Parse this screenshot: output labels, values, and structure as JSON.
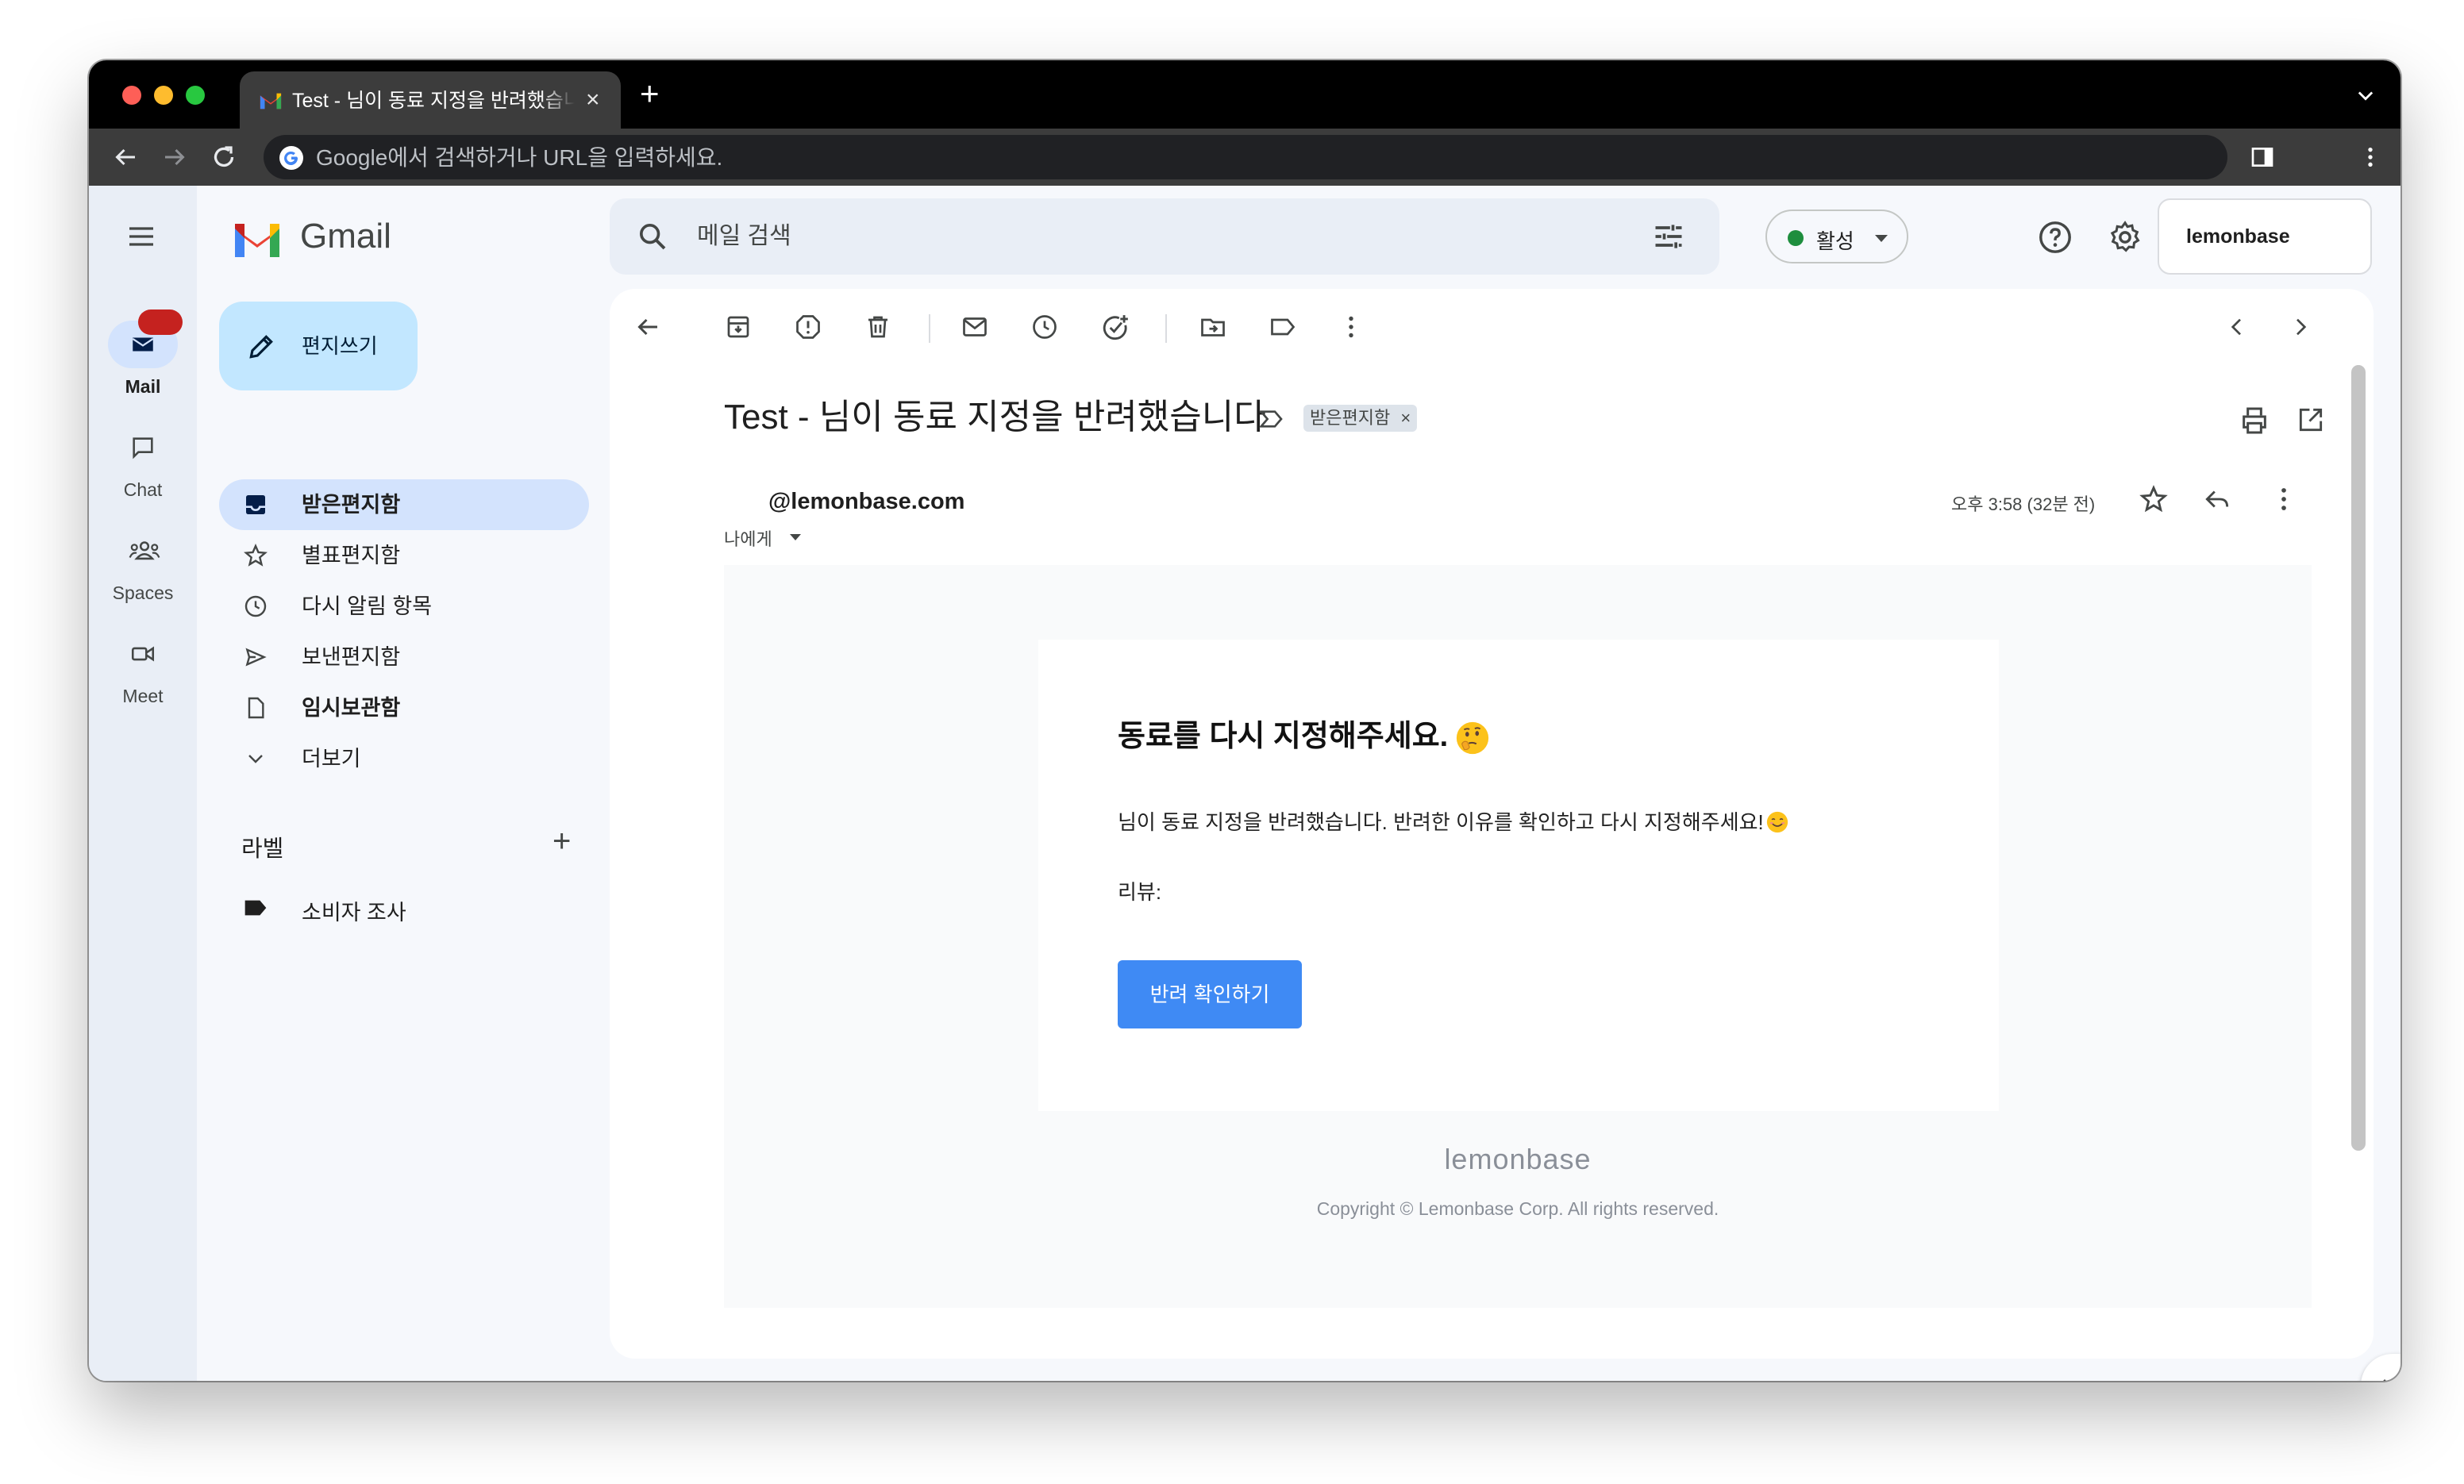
{
  "browser": {
    "tab_title": "Test - 님이 동료 지정을 반려했습니다",
    "tab_close": "×",
    "new_tab": "+",
    "omnibox_placeholder": "Google에서 검색하거나 URL을 입력하세요."
  },
  "rail": {
    "items": [
      {
        "label": "Mail",
        "icon": "mail-icon"
      },
      {
        "label": "Chat",
        "icon": "chat-icon"
      },
      {
        "label": "Spaces",
        "icon": "spaces-icon"
      },
      {
        "label": "Meet",
        "icon": "meet-icon"
      }
    ]
  },
  "sidebar": {
    "logo_text": "Gmail",
    "compose_label": "편지쓰기",
    "nav": [
      {
        "label": "받은편지함",
        "icon": "inbox-icon"
      },
      {
        "label": "별표편지함",
        "icon": "star-icon"
      },
      {
        "label": "다시 알림 항목",
        "icon": "clock-icon"
      },
      {
        "label": "보낸편지함",
        "icon": "send-icon"
      },
      {
        "label": "임시보관함",
        "icon": "draft-icon"
      },
      {
        "label": "더보기",
        "icon": "chevron-down-icon"
      }
    ],
    "labels_title": "라벨",
    "labels_add": "+",
    "labels": [
      {
        "label": "소비자 조사",
        "icon": "label-icon"
      }
    ]
  },
  "header": {
    "search_placeholder": "메일 검색",
    "status_label": "활성",
    "account_name": "lemonbase"
  },
  "message": {
    "subject": "Test - 님이 동료 지정을 반려했습니다",
    "inbox_chip": "받은편지함",
    "inbox_chip_remove": "×",
    "sender": "@lemonbase.com",
    "recipient": "나에게",
    "time": "오후 3:58 (32분 전)",
    "email": {
      "heading": "동료를 다시 지정해주세요.",
      "body": "님이 동료 지정을 반려했습니다. 반려한 이유를 확인하고 다시 지정해주세요!",
      "review_label": "리뷰:",
      "button_label": "반려 확인하기",
      "footer_brand": "lemonbase",
      "footer_copyright": "Copyright © Lemonbase Corp. All rights reserved."
    }
  },
  "colors": {
    "accent_blue": "#3f8af4",
    "compose_bg": "#c2e7ff",
    "nav_active_bg": "#d3e3fd",
    "status_green": "#1e8e3e",
    "badge_red": "#c5221f"
  }
}
